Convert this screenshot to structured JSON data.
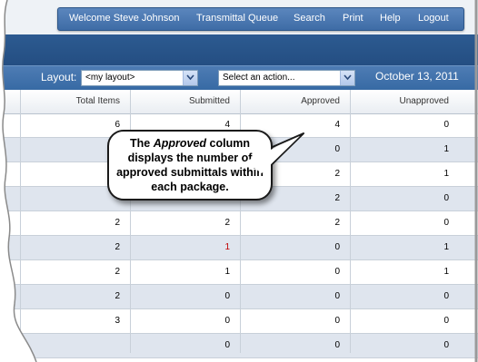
{
  "nav": {
    "items": [
      "Welcome Steve Johnson",
      "Transmittal Queue",
      "Search",
      "Print",
      "Help",
      "Logout"
    ]
  },
  "toolbar": {
    "layout_label": "Layout:",
    "layout_value": "<my layout>",
    "action_value": "Select an action...",
    "date": "October 13, 2011"
  },
  "table": {
    "headers": [
      "Total Items",
      "Submitted",
      "Approved",
      "Unapproved"
    ],
    "rows": [
      [
        "6",
        "4",
        "4",
        "0"
      ],
      [
        "",
        "",
        "0",
        "1"
      ],
      [
        "",
        "",
        "2",
        "1"
      ],
      [
        "",
        "",
        "2",
        "0"
      ],
      [
        "2",
        "2",
        "2",
        "0"
      ],
      [
        "2",
        "1",
        "0",
        "1"
      ],
      [
        "2",
        "1",
        "0",
        "1"
      ],
      [
        "2",
        "0",
        "0",
        "0"
      ],
      [
        "3",
        "0",
        "0",
        "0"
      ],
      [
        "",
        "0",
        "0",
        "0"
      ]
    ],
    "red_cells": [
      "5-1"
    ]
  },
  "callout": {
    "prefix": "The ",
    "emph": "Approved",
    "suffix": " column displays the number of approved submittals within each package."
  },
  "colors": {
    "nav_blue": "#3e6ca6",
    "alt_row": "#dfe5ee",
    "highlight_red": "#c00000"
  }
}
